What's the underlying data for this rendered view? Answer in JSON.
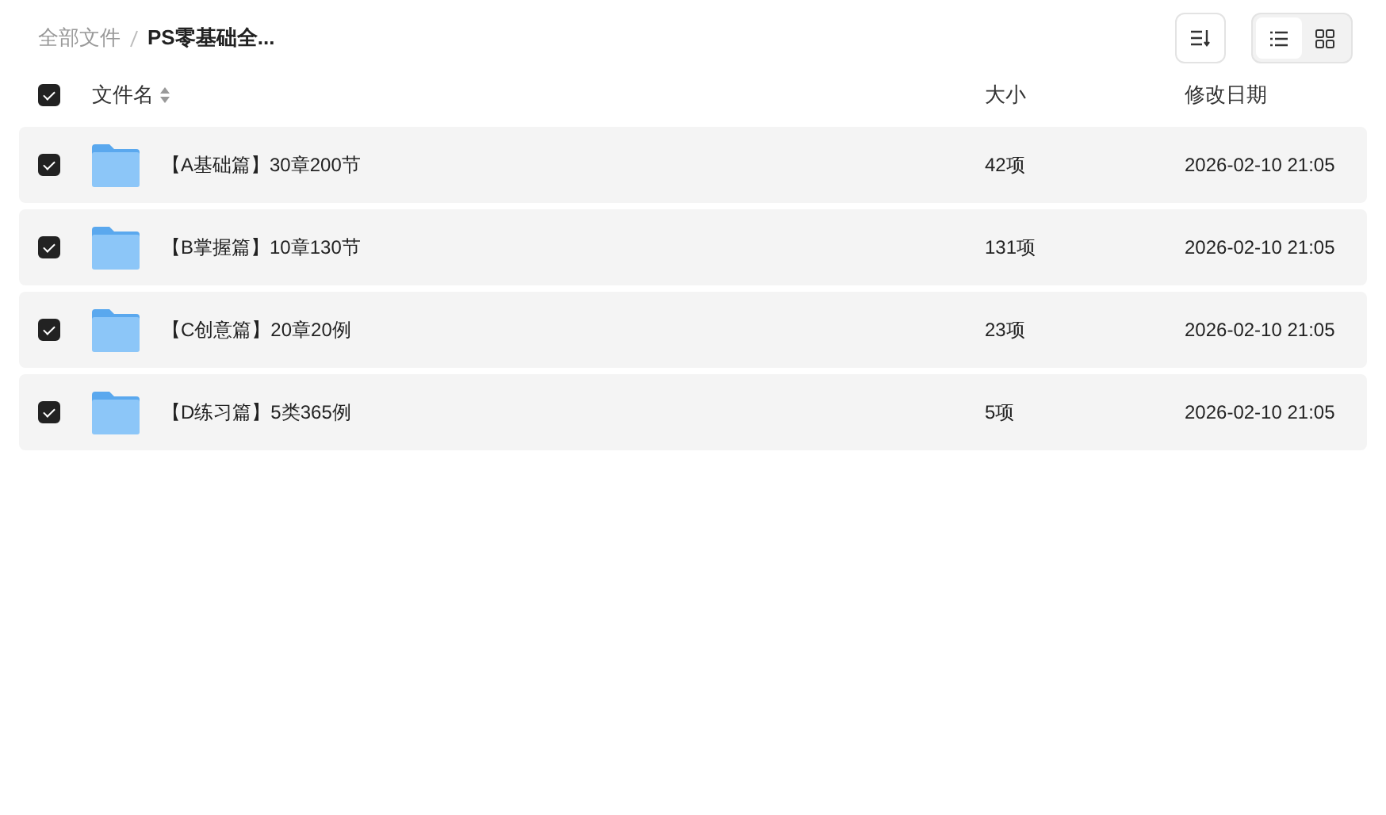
{
  "breadcrumb": [
    {
      "label": "全部文件",
      "current": false
    },
    {
      "label": "PS零基础全...",
      "current": true
    }
  ],
  "toolbar": {
    "view_modes": [
      {
        "kind": "list",
        "selected": true
      },
      {
        "kind": "grid",
        "selected": false
      }
    ]
  },
  "table": {
    "select_all": {
      "checked": true
    },
    "columns": [
      "文件名",
      "大小",
      "修改日期"
    ],
    "rows": [
      {
        "checked": true,
        "name": "【A基础篇】30章200节",
        "size": "42项",
        "modified": "2026-02-10 21:05"
      },
      {
        "checked": true,
        "name": "【B掌握篇】10章130节",
        "size": "131项",
        "modified": "2026-02-10 21:05"
      },
      {
        "checked": true,
        "name": "【C创意篇】20章20例",
        "size": "23项",
        "modified": "2026-02-10 21:05"
      },
      {
        "checked": true,
        "name": "【D练习篇】5类365例",
        "size": "5项",
        "modified": "2026-02-10 21:05"
      }
    ]
  }
}
